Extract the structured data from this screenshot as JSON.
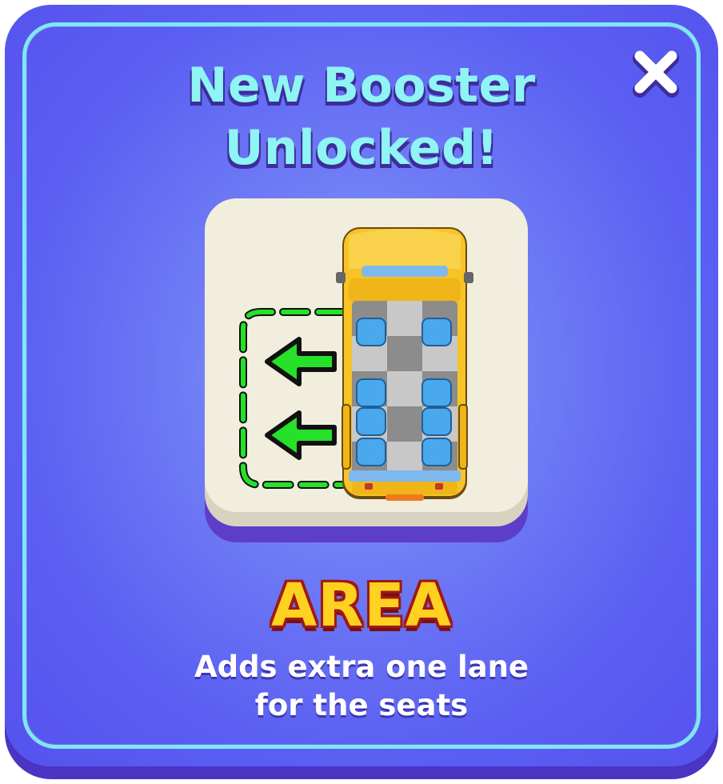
{
  "popup": {
    "title_line1": "New Booster",
    "title_line2": "Unlocked!",
    "booster_name": "AREA",
    "description_line1": "Adds extra one lane",
    "description_line2": "for the seats",
    "close_icon": "close-icon"
  },
  "colors": {
    "panel": "#5a5ef2",
    "panel_border": "#7fe7f2",
    "title": "#8ff4f4",
    "booster_name": "#ffd21f",
    "booster_outline": "#a01818",
    "card": "#f1eedd",
    "arrow": "#22dd22",
    "bus": "#f7c326",
    "seat": "#4aa8ec"
  },
  "icons": {
    "booster_illustration": "bus-area-booster-icon",
    "arrow": "green-arrow-left-icon"
  }
}
